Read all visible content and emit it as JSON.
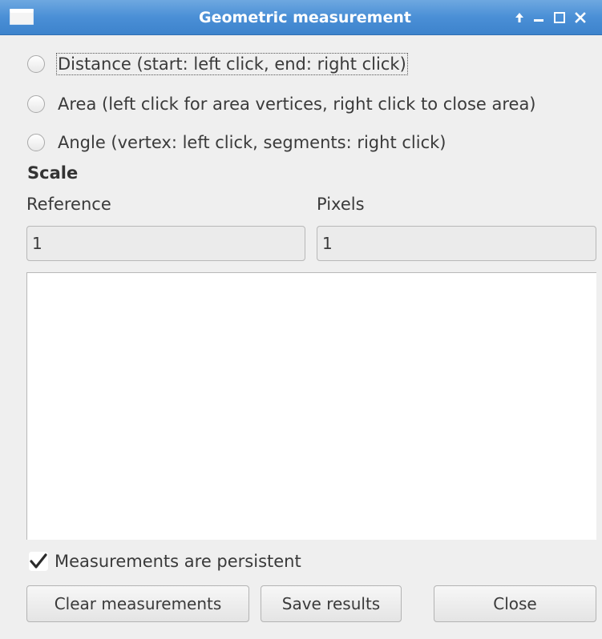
{
  "window": {
    "title": "Geometric measurement",
    "controls": {
      "keep_above": "↑",
      "minimize": "_",
      "maximize": "□",
      "close": "✕"
    }
  },
  "modes": [
    {
      "label": "Distance (start: left click, end: right click)",
      "selected": false
    },
    {
      "label": "Area (left click for area vertices, right click to close area)",
      "selected": false
    },
    {
      "label": "Angle (vertex: left click, segments: right click)",
      "selected": false
    }
  ],
  "scale": {
    "title": "Scale",
    "reference_label": "Reference",
    "pixels_label": "Pixels",
    "reference_value": "1",
    "pixels_value": "1"
  },
  "results": {
    "text": ""
  },
  "persistent": {
    "label": "Measurements are persistent",
    "checked": true
  },
  "buttons": {
    "clear": "Clear measurements",
    "save": "Save results",
    "close": "Close"
  }
}
